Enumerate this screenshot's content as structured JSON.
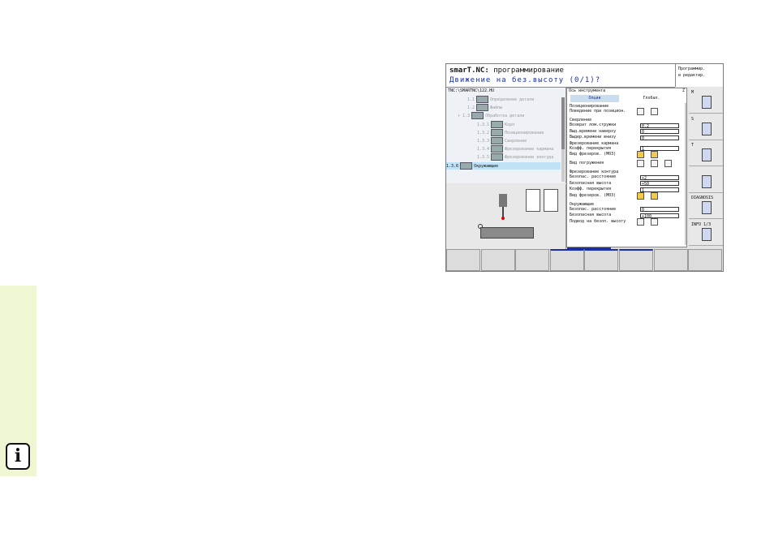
{
  "header": {
    "app_name": "smarT.NC:",
    "mode_title": "программирование",
    "prompt": "Движение на без.высоту (0/1)?"
  },
  "mode_panel": {
    "line1": "Программир.",
    "line2": "и редактир."
  },
  "tree": {
    "path": "TNC:\\SMARTNC\\122.HU",
    "items": [
      {
        "num": "1.1",
        "label": "Определение детали",
        "indent": 1,
        "selected": false
      },
      {
        "num": "1.2",
        "label": "Файлы",
        "indent": 1,
        "selected": false
      },
      {
        "num": "▾ 1.3",
        "label": "Обработка детали",
        "indent": 0,
        "selected": false
      },
      {
        "num": "1.3.1",
        "label": "Корп",
        "indent": 2,
        "selected": false
      },
      {
        "num": "1.3.2",
        "label": "Позиционирование",
        "indent": 2,
        "selected": false
      },
      {
        "num": "1.3.3",
        "label": "Сверление",
        "indent": 2,
        "selected": false
      },
      {
        "num": "1.3.4",
        "label": "Фрезерование кармана",
        "indent": 2,
        "selected": false
      },
      {
        "num": "1.3.5",
        "label": "Фрезерование контура",
        "indent": 2,
        "selected": false
      },
      {
        "num": "1.3.6",
        "label": "Окружающие",
        "indent": 2,
        "selected": true
      }
    ]
  },
  "form": {
    "axis_label": "Ось инструмента",
    "axis_value": "Z",
    "tab_options": "Опции",
    "tab_global": "Глобал.",
    "rows": [
      {
        "text": "Позиционирование",
        "value": "",
        "kind": "section"
      },
      {
        "text": "Поведение при позицион.",
        "value": "",
        "kind": "radio2"
      },
      {
        "text": "Сверление",
        "value": "",
        "kind": "section"
      },
      {
        "text": "Возврат лом.стружки",
        "value": "0.2",
        "kind": "field"
      },
      {
        "text": "Выд.времени наверху",
        "value": "0",
        "kind": "field"
      },
      {
        "text": "Выдер.времени внизу",
        "value": "0",
        "kind": "field"
      },
      {
        "text": "Фрезерование кармана",
        "value": "",
        "kind": "section"
      },
      {
        "text": "Коэфф. перекрытия",
        "value": "1",
        "kind": "field"
      },
      {
        "text": "Вид фрезеров. (M03)",
        "value": "",
        "kind": "radio2y"
      },
      {
        "text": "Вид погружения",
        "value": "",
        "kind": "radio3"
      },
      {
        "text": "Фрезерование контура",
        "value": "",
        "kind": "section"
      },
      {
        "text": "Безопас. расстояние",
        "value": "+2",
        "kind": "field"
      },
      {
        "text": "Безопасная высота",
        "value": "+50",
        "kind": "field"
      },
      {
        "text": "Коэфф. перекрытия",
        "value": "1",
        "kind": "field"
      },
      {
        "text": "Вид фрезеров. (M03)",
        "value": "",
        "kind": "radio2y"
      },
      {
        "text": "Окружающие",
        "value": "",
        "kind": "section"
      },
      {
        "text": "Безопас. расстояние",
        "value": "0",
        "kind": "field"
      },
      {
        "text": "Безопасная высота",
        "value": "+100",
        "kind": "field"
      },
      {
        "text": "Подвод на безоп. высоту",
        "value": "",
        "kind": "radio2"
      }
    ]
  },
  "softkeys_right": [
    {
      "label": "M"
    },
    {
      "label": "S"
    },
    {
      "label": "T"
    },
    {
      "label": ""
    },
    {
      "label": "DIAGNOSIS"
    },
    {
      "label": "INFO 1/3"
    }
  ],
  "colors": {
    "prompt_blue": "#1b2fa8",
    "selection": "#bfe2f6",
    "sidetab": "#eef7d2"
  },
  "info_icon_glyph": "i"
}
